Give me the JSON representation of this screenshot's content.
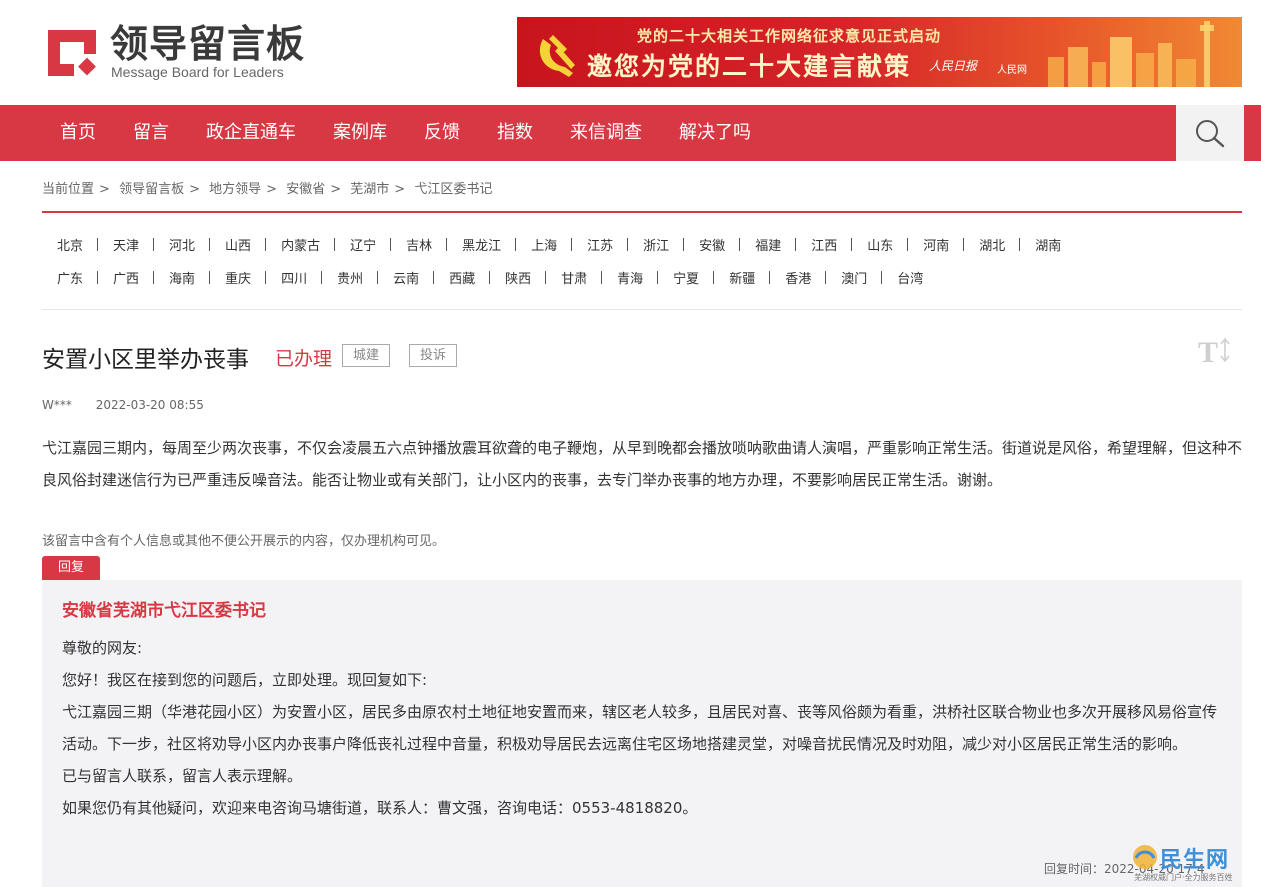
{
  "header": {
    "logo_title": "领导留言板",
    "logo_subtitle": "Message Board for Leaders",
    "banner_top": "党的二十大相关工作网络征求意见正式启动",
    "banner_main": "邀您为党的二十大建言献策",
    "banner_logo1": "人民日报",
    "banner_logo2": "人民网",
    "accent_color": "#d83844"
  },
  "nav": {
    "items": [
      "首页",
      "留言",
      "政企直通车",
      "案例库",
      "反馈",
      "指数",
      "来信调查",
      "解决了吗"
    ],
    "search_icon": "search-icon"
  },
  "breadcrumb": {
    "items": [
      "当前位置",
      "领导留言板",
      "地方领导",
      "安徽省",
      "芜湖市",
      "弋江区委书记"
    ],
    "separator": ">"
  },
  "provinces": {
    "row1": [
      "北京",
      "天津",
      "河北",
      "山西",
      "内蒙古",
      "辽宁",
      "吉林",
      "黑龙江",
      "上海",
      "江苏",
      "浙江",
      "安徽",
      "福建",
      "江西",
      "山东",
      "河南",
      "湖北",
      "湖南"
    ],
    "row2": [
      "广东",
      "广西",
      "海南",
      "重庆",
      "四川",
      "贵州",
      "云南",
      "西藏",
      "陕西",
      "甘肃",
      "青海",
      "宁夏",
      "新疆",
      "香港",
      "澳门",
      "台湾"
    ]
  },
  "message": {
    "title": "安置小区里举办丧事",
    "status": "已办理",
    "tag_category": "城建",
    "tag_type": "投诉",
    "author": "W***",
    "time": "2022-03-20 08:55",
    "content": "弋江嘉园三期内，每周至少两次丧事，不仅会凌晨五六点钟播放震耳欲聋的电子鞭炮，从早到晚都会播放唢呐歌曲请人演唱，严重影响正常生活。街道说是风俗，希望理解，但这种不良风俗封建迷信行为已严重违反噪音法。能否让物业或有关部门，让小区内的丧事，去专门举办丧事的地方办理，不要影响居民正常生活。谢谢。",
    "privacy_note": "该留言中含有个人信息或其他不便公开展示的内容，仅办理机构可见。"
  },
  "reply": {
    "tab_label": "回复",
    "org": "安徽省芜湖市弋江区委书记",
    "paragraphs": [
      "尊敬的网友:",
      "您好！我区在接到您的问题后，立即处理。现回复如下:",
      "弋江嘉园三期（华港花园小区）为安置小区，居民多由原农村土地征地安置而来，辖区老人较多，且居民对喜、丧等风俗颇为看重，洪桥社区联合物业也多次开展移风易俗宣传活动。下一步，社区将劝导小区内办丧事户降低丧礼过程中音量，积极劝导居民去远离住宅区场地搭建灵堂，对噪音扰民情况及时劝阻，减少对小区居民正常生活的影响。",
      "已与留言人联系，留言人表示理解。",
      "如果您仍有其他疑问，欢迎来电咨询马塘街道，联系人：曹文强，咨询电话：0553-4818820。"
    ],
    "reply_time": "回复时间：2022-04-20 17:4"
  },
  "watermark": {
    "text": "民生网",
    "small": "芜湖权威门户·全力服务百姓"
  }
}
